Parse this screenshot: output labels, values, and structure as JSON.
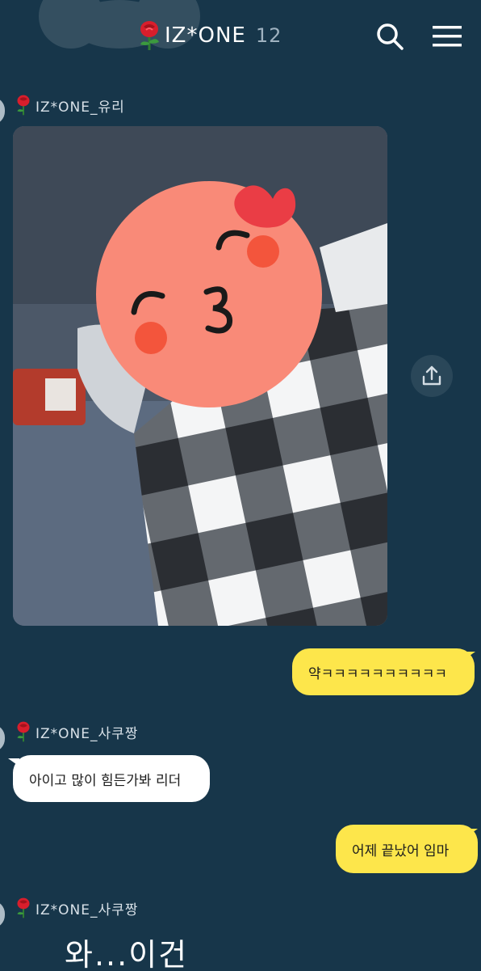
{
  "header": {
    "title": "IZ*ONE",
    "member_count": "12"
  },
  "messages": [
    {
      "sender": "IZ*ONE_유리",
      "type": "photo"
    },
    {
      "type": "text",
      "mine": true,
      "text": "약ㅋㅋㅋㅋㅋㅋㅋㅋㅋㅋ"
    },
    {
      "sender": "IZ*ONE_사쿠짱",
      "type": "text",
      "mine": false,
      "text": "아이고 많이 힘든가봐 리더"
    },
    {
      "type": "text",
      "mine": true,
      "text": "어제 끝났어 임마"
    },
    {
      "sender": "IZ*ONE_사쿠짱",
      "type": "emoticon",
      "text": "와...이건"
    }
  ],
  "colors": {
    "background": "#17364a",
    "my_bubble": "#fde64b",
    "their_bubble": "#ffffff",
    "rose": "#d81e2c"
  },
  "icons": {
    "search": "search-icon",
    "menu": "hamburger-menu-icon",
    "share": "share-icon",
    "rose": "rose-icon"
  }
}
